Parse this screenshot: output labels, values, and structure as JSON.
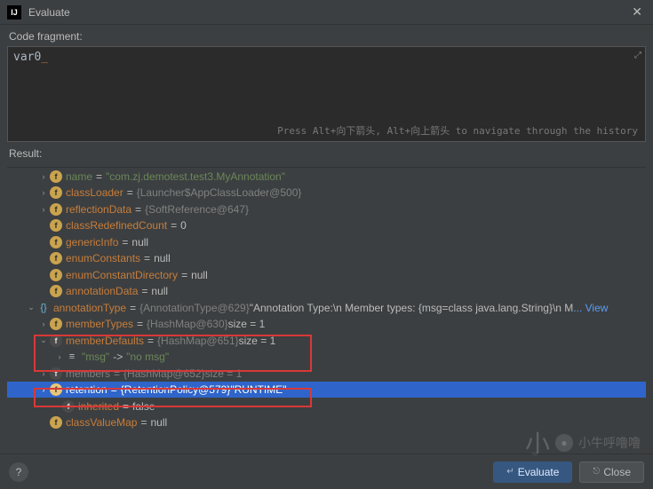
{
  "window": {
    "title": "Evaluate"
  },
  "labels": {
    "code_fragment": "Code fragment:",
    "result": "Result:",
    "hint": "Press Alt+向下箭头, Alt+向上箭头 to navigate through the history"
  },
  "editor": {
    "content": "var0"
  },
  "tree": [
    {
      "indent": 34,
      "arrow": ">",
      "icon": "f",
      "name": "name",
      "nameGray": true,
      "eq": "=",
      "valType": "",
      "valStr": "\"com.zj.demotest.test3.MyAnnotation\"",
      "green": true
    },
    {
      "indent": 34,
      "arrow": ">",
      "icon": "f",
      "name": "classLoader",
      "eq": "=",
      "valType": "{Launcher$AppClassLoader@500}",
      "valStr": ""
    },
    {
      "indent": 34,
      "arrow": ">",
      "icon": "f",
      "name": "reflectionData",
      "eq": "=",
      "valType": "{SoftReference@647}",
      "valStr": ""
    },
    {
      "indent": 34,
      "arrow": "",
      "icon": "f",
      "name": "classRedefinedCount",
      "eq": "=",
      "valType": "",
      "valStr": "0"
    },
    {
      "indent": 34,
      "arrow": "",
      "icon": "f",
      "name": "genericInfo",
      "eq": "=",
      "valType": "",
      "valStr": "null"
    },
    {
      "indent": 34,
      "arrow": "",
      "icon": "f",
      "name": "enumConstants",
      "eq": "=",
      "valType": "",
      "valStr": "null"
    },
    {
      "indent": 34,
      "arrow": "",
      "icon": "f",
      "name": "enumConstantDirectory",
      "eq": "=",
      "valType": "",
      "valStr": "null"
    },
    {
      "indent": 34,
      "arrow": "",
      "icon": "f",
      "name": "annotationData",
      "eq": "=",
      "valType": "",
      "valStr": "null"
    },
    {
      "indent": 20,
      "arrow": "v",
      "icon": "obj",
      "name": "annotationType",
      "eq": "=",
      "valType": "{AnnotationType@629}",
      "valStr": " \"Annotation Type:\\n    Member types: {msg=class java.lang.String}\\n   M",
      "view": "... View"
    },
    {
      "indent": 34,
      "arrow": ">",
      "icon": "f",
      "name": "memberTypes",
      "eq": "=",
      "valType": "{HashMap@630} ",
      "valStr": " size = 1"
    },
    {
      "indent": 34,
      "arrow": "v",
      "icon": "fd",
      "name": "memberDefaults",
      "eq": "=",
      "valType": "{HashMap@651} ",
      "valStr": " size = 1"
    },
    {
      "indent": 52,
      "arrow": ">",
      "icon": "eq",
      "name": "\"msg\"",
      "green": true,
      "eq": "->",
      "valType": "",
      "valStr": "\"no msg\"",
      "greenVal": true
    },
    {
      "indent": 34,
      "arrow": ">",
      "icon": "fd",
      "name": "members",
      "nameGray": true,
      "eq": "=",
      "valType": "{HashMap@652} ",
      "valStr": " size = 1",
      "grayAll": true
    },
    {
      "indent": 34,
      "arrow": ">",
      "icon": "f",
      "name": "retention",
      "eq": "=",
      "valType": "{RetentionPolicy@579}",
      "valStr": " \"RUNTIME\"",
      "selected": true
    },
    {
      "indent": 48,
      "arrow": "",
      "icon": "fd",
      "name": "inherited",
      "eq": "=",
      "valType": "",
      "valStr": "false"
    },
    {
      "indent": 34,
      "arrow": "",
      "icon": "f",
      "name": "classValueMap",
      "eq": "=",
      "valType": "",
      "valStr": "null"
    }
  ],
  "buttons": {
    "evaluate": "Evaluate",
    "close": "Close"
  },
  "watermark": {
    "big": "小",
    "small": "小牛呼噜噜"
  }
}
